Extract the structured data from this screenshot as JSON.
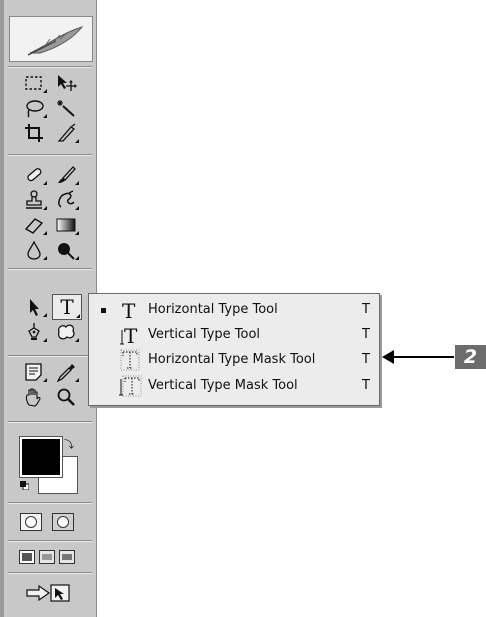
{
  "toolbox": {
    "tools": [
      {
        "name": "rectangular-marquee-icon"
      },
      {
        "name": "move-icon"
      },
      {
        "name": "lasso-icon"
      },
      {
        "name": "magic-wand-icon"
      },
      {
        "name": "crop-icon"
      },
      {
        "name": "slice-icon"
      },
      {
        "name": "healing-brush-icon"
      },
      {
        "name": "brush-icon"
      },
      {
        "name": "clone-stamp-icon"
      },
      {
        "name": "history-brush-icon"
      },
      {
        "name": "eraser-icon"
      },
      {
        "name": "gradient-icon"
      },
      {
        "name": "blur-icon"
      },
      {
        "name": "dodge-icon"
      },
      {
        "name": "path-selection-icon"
      },
      {
        "name": "type-icon",
        "label": "T"
      },
      {
        "name": "pen-icon"
      },
      {
        "name": "custom-shape-icon"
      },
      {
        "name": "notes-icon"
      },
      {
        "name": "eyedropper-icon"
      },
      {
        "name": "hand-icon"
      },
      {
        "name": "zoom-icon"
      }
    ],
    "foreground_color": "#000000",
    "background_color": "#ffffff"
  },
  "flyout_menu": {
    "items": [
      {
        "label": "Horizontal Type Tool",
        "shortcut": "T",
        "selected": true
      },
      {
        "label": "Vertical Type Tool",
        "shortcut": "T",
        "selected": false
      },
      {
        "label": "Horizontal Type Mask Tool",
        "shortcut": "T",
        "selected": false
      },
      {
        "label": "Vertical Type Mask Tool",
        "shortcut": "T",
        "selected": false
      }
    ]
  },
  "callout": {
    "number": "2",
    "color": "#6c6c6c"
  }
}
